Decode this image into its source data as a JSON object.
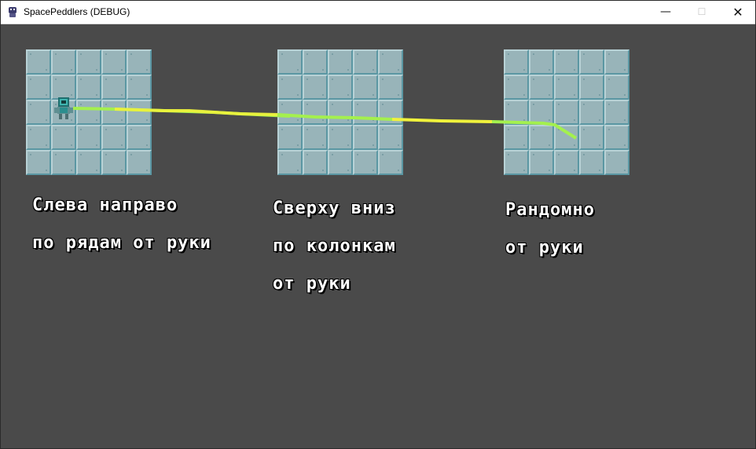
{
  "window": {
    "title": "SpacePeddlers (DEBUG)",
    "minimize_glyph": "—",
    "maximize_glyph": "☐",
    "close_glyph": "✕",
    "icon": "robot-app-icon"
  },
  "grid": {
    "rows": 5,
    "cols": 5
  },
  "panels": [
    {
      "captions": [
        "Слева направо",
        "по рядам от руки"
      ]
    },
    {
      "captions": [
        "Сверху вниз",
        "по колонкам",
        "от руки"
      ]
    },
    {
      "captions": [
        "Рандомно",
        "от руки"
      ]
    }
  ],
  "colors": {
    "background": "#4a4a4a",
    "tile": "#98b4b9",
    "line_yellow": "#f5f542",
    "line_green": "#9df25a",
    "player": "#2b8e8e"
  }
}
